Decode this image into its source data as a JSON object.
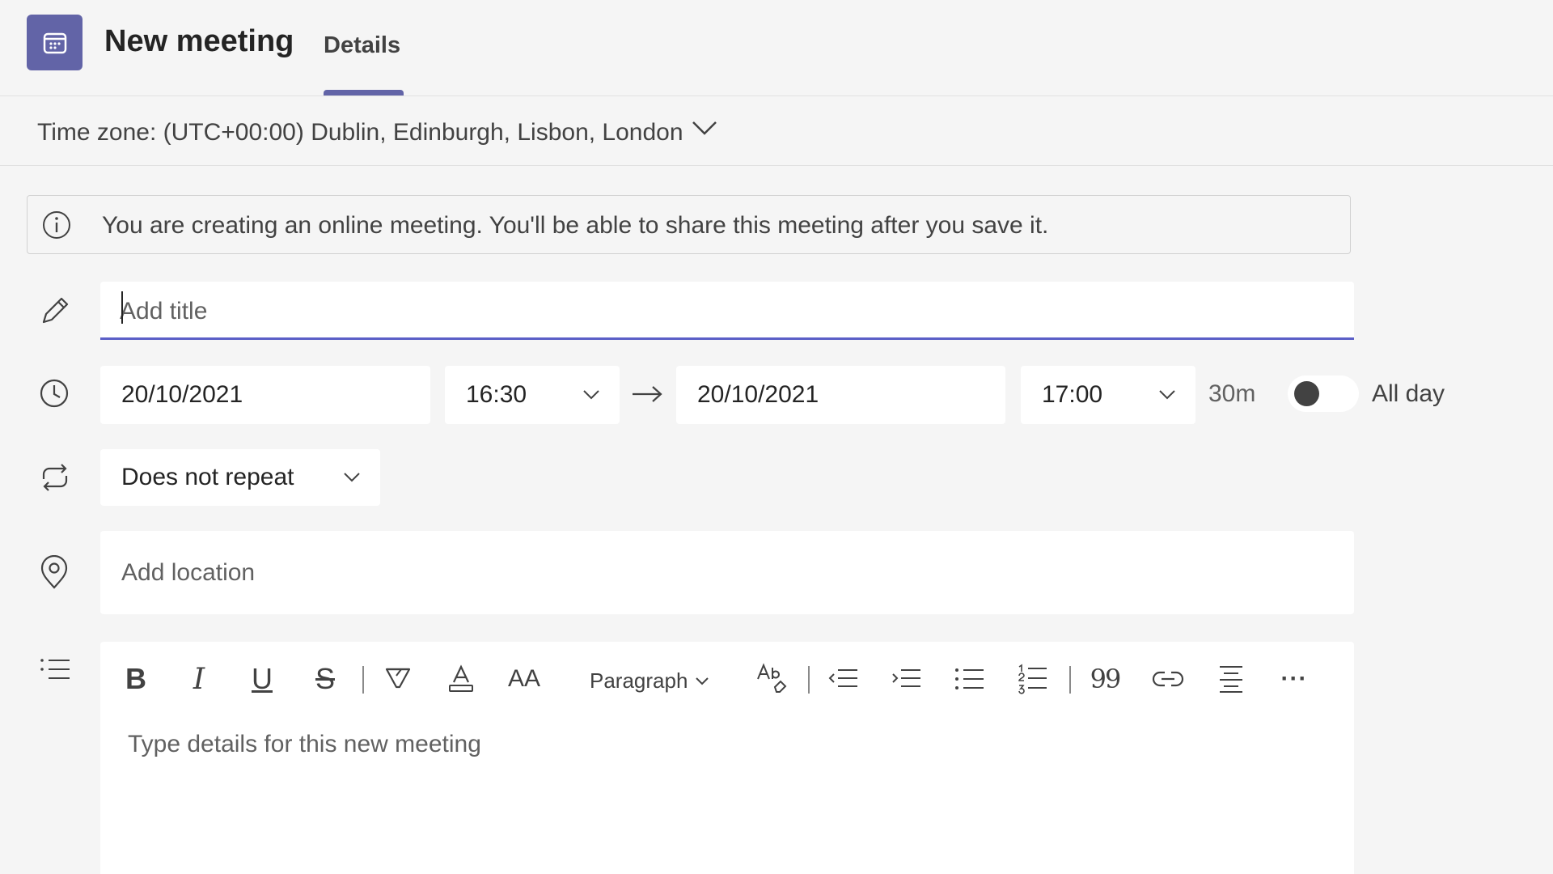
{
  "header": {
    "app_icon": "calendar-icon",
    "title": "New meeting",
    "tabs": [
      {
        "label": "Details",
        "active": true
      }
    ]
  },
  "timezone": {
    "label": "Time zone:",
    "value": "(UTC+00:00) Dublin, Edinburgh, Lisbon, London"
  },
  "info_banner": {
    "text": "You are creating an online meeting. You'll be able to share this meeting after you save it."
  },
  "form": {
    "title_placeholder": "Add title",
    "start_date": "20/10/2021",
    "start_time": "16:30",
    "end_date": "20/10/2021",
    "end_time": "17:00",
    "duration": "30m",
    "all_day_label": "All day",
    "all_day_on": false,
    "repeat": "Does not repeat",
    "location_placeholder": "Add location"
  },
  "editor": {
    "toolbar": {
      "bold": "B",
      "italic": "I",
      "underline": "U",
      "strikethrough": "S",
      "font_size": "AA",
      "paragraph": "Paragraph",
      "quote": "99",
      "more": "···"
    },
    "placeholder": "Type details for this new meeting"
  },
  "colors": {
    "accent": "#6264a7",
    "background": "#f5f5f5"
  }
}
